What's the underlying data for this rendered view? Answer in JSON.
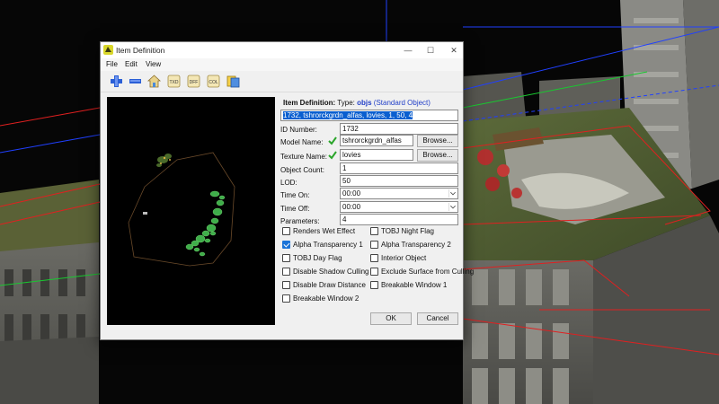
{
  "window": {
    "title": "Item Definition",
    "controls": {
      "minimize": "—",
      "maximize": "☐",
      "close": "✕"
    }
  },
  "menu": {
    "file": "File",
    "edit": "Edit",
    "view": "View"
  },
  "toolbar": {
    "icons": [
      "add-icon",
      "remove-icon",
      "house-icon",
      "txd-icon",
      "dff-icon",
      "col-icon",
      "export-icon"
    ],
    "txd_label": "TXD",
    "dff_label": "DFF",
    "col_label": "COL"
  },
  "form": {
    "heading_label": "Item Definition:",
    "type_label": "Type:",
    "type_value": "objs",
    "type_desc": "(Standard Object)",
    "definition_line": "1732, tshrorckgrdn_alfas, lovies, 1, 50, 4",
    "id_number_label": "ID Number:",
    "id_number": "1732",
    "model_name_label": "Model Name:",
    "model_name": "tshrorckgrdn_alfas",
    "texture_name_label": "Texture Name:",
    "texture_name": "lovies",
    "browse_label": "Browse...",
    "object_count_label": "Object Count:",
    "object_count": "1",
    "lod_label": "LOD:",
    "lod": "50",
    "time_on_label": "Time On:",
    "time_on": "00:00",
    "time_off_label": "Time Off:",
    "time_off": "00:00",
    "parameters_label": "Parameters:",
    "parameters": "4"
  },
  "flags": {
    "renders_wet": {
      "label": "Renders Wet Effect",
      "checked": false
    },
    "tobj_night": {
      "label": "TOBJ Night Flag",
      "checked": false
    },
    "alpha1": {
      "label": "Alpha Transparency 1",
      "checked": true
    },
    "alpha2": {
      "label": "Alpha Transparency 2",
      "checked": false
    },
    "tobj_day": {
      "label": "TOBJ Day Flag",
      "checked": false
    },
    "interior": {
      "label": "Interior Object",
      "checked": false
    },
    "disable_shadow": {
      "label": "Disable Shadow Culling",
      "checked": false
    },
    "exclude_surface": {
      "label": "Exclude Surface from Culling",
      "checked": false
    },
    "disable_draw": {
      "label": "Disable Draw Distance",
      "checked": false
    },
    "breakable1": {
      "label": "Breakable Window 1",
      "checked": false
    },
    "breakable2": {
      "label": "Breakable Window 2",
      "checked": false
    }
  },
  "actions": {
    "ok": "OK",
    "cancel": "Cancel"
  },
  "colors": {
    "accent": "#0a5fd0",
    "type_blue": "#2340c8",
    "checkbox_checked": "#1a73d8"
  }
}
